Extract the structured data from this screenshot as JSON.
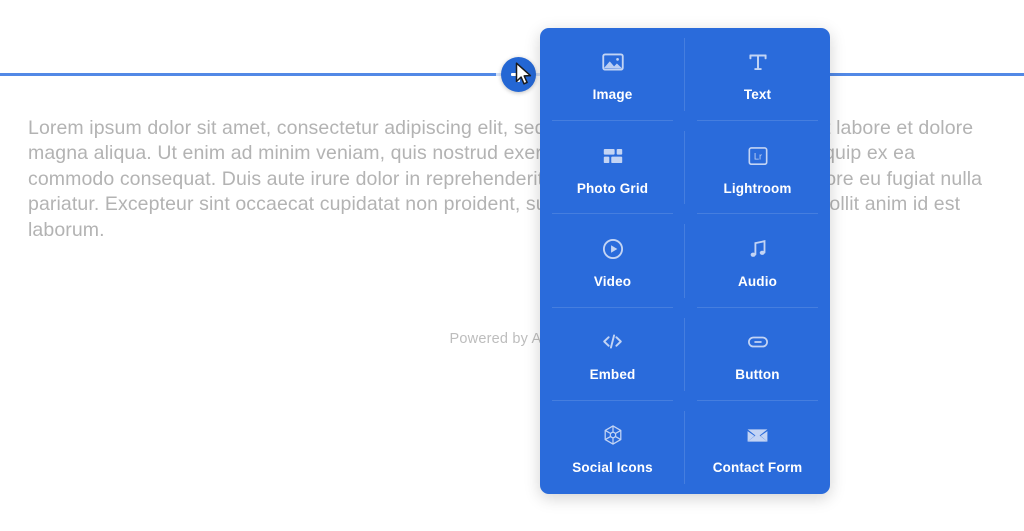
{
  "canvas": {
    "body_copy": "Lorem ipsum dolor sit amet, consectetur adipiscing elit, sed do eiusmod tempor incididunt ut labore et dolore magna aliqua. Ut enim ad minim veniam, quis nostrud exercitation ullamco laboris nisi ut aliquip ex ea commodo consequat. Duis aute irure dolor in reprehenderit in voluptate velit esse cillum dolore eu fugiat nulla pariatur. Excepteur sint occaecat cupidatat non proident, sunt in culpa qui officia deserunt mollit anim id est laborum.",
    "powered_by": "Powered by Adobe",
    "rule_color": "#5289e6",
    "text_color": "#b3b3b3"
  },
  "add_block_button": {
    "label": "+",
    "icon": "plus-icon",
    "color": "#2467d4"
  },
  "cursor": {
    "icon": "mouse-pointer-icon"
  },
  "insert_panel": {
    "background": "#2a6bdb",
    "icon_color": "#c3d4f4",
    "label_color": "#ffffff",
    "items": [
      {
        "label": "Image",
        "icon": "image-icon"
      },
      {
        "label": "Text",
        "icon": "text-icon"
      },
      {
        "label": "Photo Grid",
        "icon": "photo-grid-icon"
      },
      {
        "label": "Lightroom",
        "icon": "lightroom-icon"
      },
      {
        "label": "Video",
        "icon": "video-play-icon"
      },
      {
        "label": "Audio",
        "icon": "audio-note-icon"
      },
      {
        "label": "Embed",
        "icon": "embed-code-icon"
      },
      {
        "label": "Button",
        "icon": "button-icon"
      },
      {
        "label": "Social Icons",
        "icon": "social-icons-icon"
      },
      {
        "label": "Contact Form",
        "icon": "contact-form-envelope-icon"
      }
    ]
  }
}
